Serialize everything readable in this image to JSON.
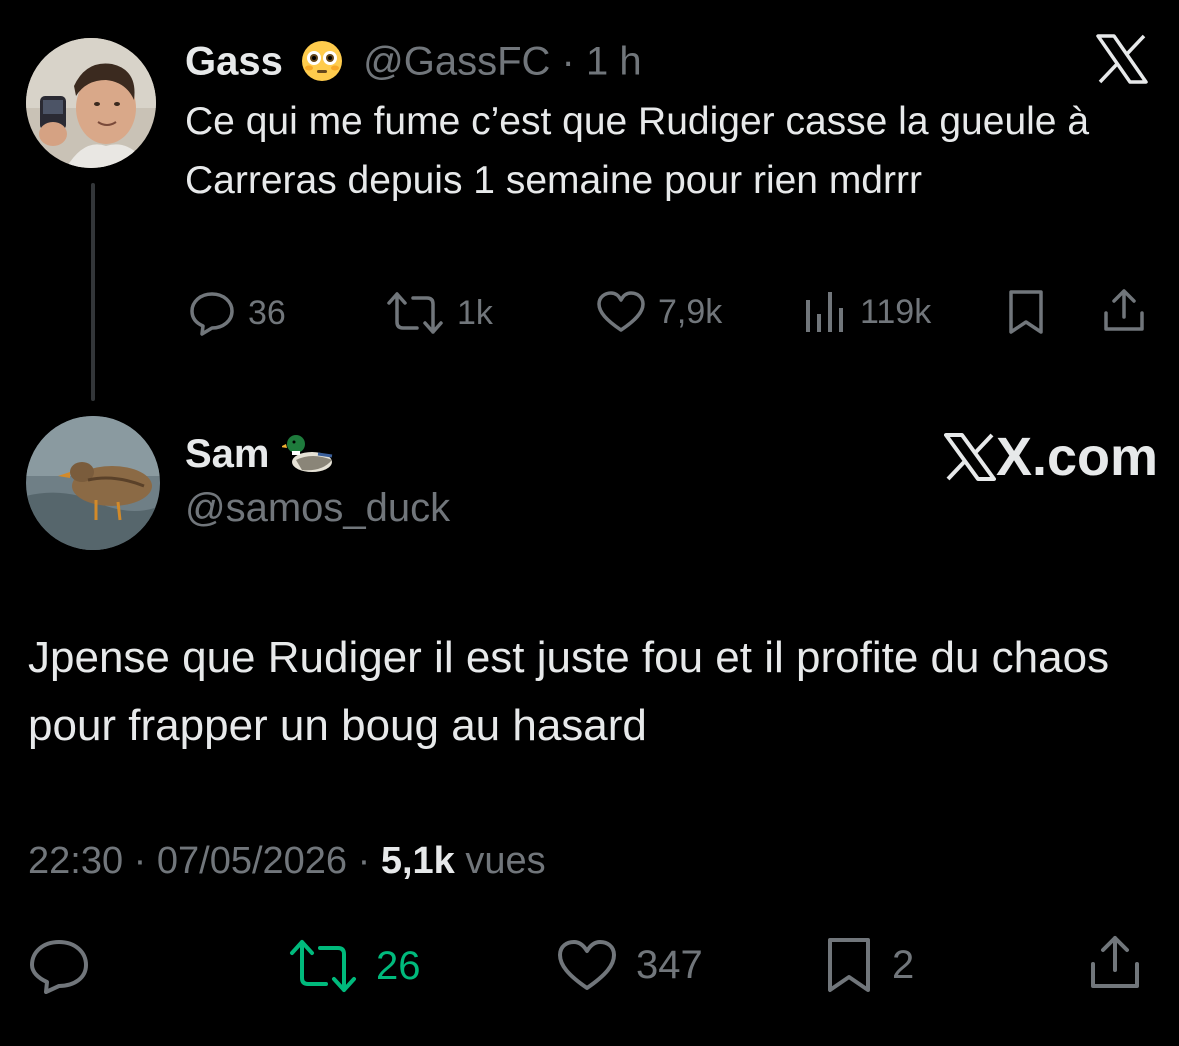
{
  "colors": {
    "background": "#000000",
    "text": "#e7e9ea",
    "muted": "#71767b",
    "retweet_active": "#00ba7c",
    "thread_line": "#333639"
  },
  "tweet": {
    "author_name": "Gass",
    "author_emoji": "flushed-face-emoji",
    "handle": "@GassFC",
    "separator": "·",
    "time": "1 h",
    "text": "Ce qui me fume c’est que Rudiger casse la gueule à Carreras depuis 1 semaine pour rien mdrrr",
    "stats": {
      "replies": "36",
      "reposts": "1k",
      "likes": "7,9k",
      "views": "119k"
    },
    "icons": [
      "reply-icon",
      "repost-icon",
      "like-icon",
      "views-icon",
      "bookmark-icon",
      "share-icon"
    ]
  },
  "brand": {
    "logo": "x-logo",
    "site_text": "X.com"
  },
  "reply": {
    "author_name": "Sam",
    "author_emoji": "duck-emoji",
    "handle": "@samos_duck",
    "text": "Jpense que Rudiger il est juste fou et il profite du chaos pour frapper un boug au hasard",
    "time": "22:30",
    "date": "07/05/2026",
    "sep": "·",
    "views_count": "5,1k",
    "views_label": "vues",
    "actions": {
      "reposts": "26",
      "likes": "347",
      "bookmarks": "2"
    }
  }
}
